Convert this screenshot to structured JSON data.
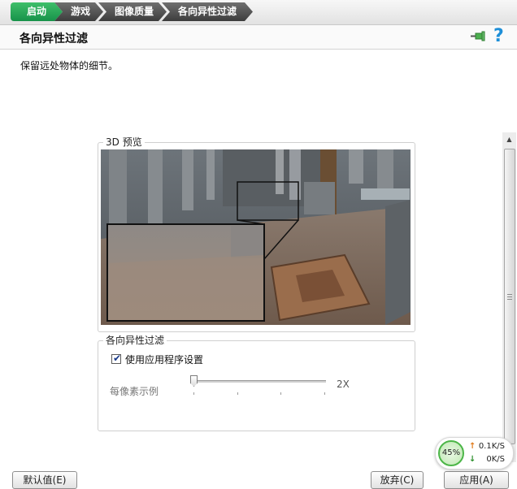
{
  "breadcrumb": [
    {
      "label": "启动"
    },
    {
      "label": "游戏"
    },
    {
      "label": "图像质量"
    },
    {
      "label": "各向异性过滤"
    }
  ],
  "header": {
    "title": "各向异性过滤",
    "help_label": "?"
  },
  "description": "保留远处物体的细节。",
  "preview": {
    "title": "3D 预览"
  },
  "af_group": {
    "title": "各向异性过滤",
    "checkbox_label": "使用应用程序设置",
    "checkbox_checked": true,
    "checkbox_mark": "✔",
    "slider_label": "每像素示例",
    "slider_value": "2X",
    "slider_level": 0
  },
  "buttons": {
    "defaults": "默认值(E)",
    "cancel": "放弃(C)",
    "apply": "应用(A)"
  },
  "net_widget": {
    "percent": "45%",
    "up": "0.1K/S",
    "down": "0K/S",
    "up_arrow": "↑",
    "down_arrow": "↓"
  },
  "scrollbar": {
    "up_arrow": "▲",
    "down_arrow": "▼"
  },
  "colors": {
    "accent_green": "#17924a",
    "crumb_dark": "#3d3d3d",
    "help_blue": "#1e8fd8"
  }
}
